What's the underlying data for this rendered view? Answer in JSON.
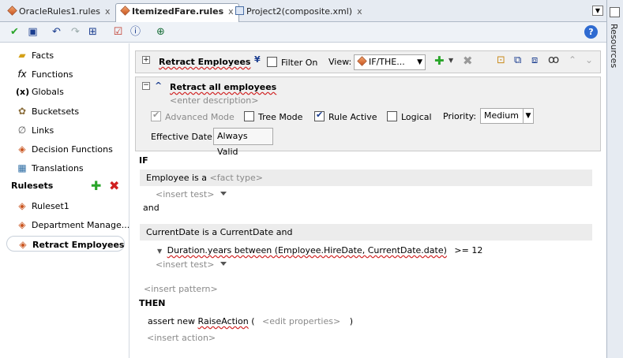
{
  "tabs": [
    {
      "label": "OracleRules1.rules",
      "close": "x"
    },
    {
      "label": "ItemizedFare.rules",
      "close": "x"
    },
    {
      "label": "Project2(composite.xml)",
      "close": "x"
    }
  ],
  "right_panel": {
    "label": "Resources"
  },
  "sidebar": {
    "items": [
      {
        "label": "Facts",
        "icon": "facts-icon"
      },
      {
        "label": "Functions",
        "icon": "fx-icon"
      },
      {
        "label": "Globals",
        "icon": "globals-icon"
      },
      {
        "label": "Bucketsets",
        "icon": "bucketsets-icon"
      },
      {
        "label": "Links",
        "icon": "links-icon"
      },
      {
        "label": "Decision Functions",
        "icon": "decision-functions-icon"
      },
      {
        "label": "Translations",
        "icon": "translations-icon"
      }
    ],
    "rulesets_header": "Rulesets",
    "rulesets": [
      {
        "label": "Ruleset1"
      },
      {
        "label": "Department Manage..."
      },
      {
        "label": "Retract Employees"
      }
    ]
  },
  "rule_header": {
    "title": "Retract Employees",
    "filter_label": "Filter On",
    "view_label": "View:",
    "view_value": "IF/THE..."
  },
  "rule": {
    "name": "Retract all employees",
    "description_placeholder": "<enter description>",
    "advanced_mode": "Advanced Mode",
    "tree_mode": "Tree Mode",
    "rule_active": "Rule Active",
    "logical": "Logical",
    "priority_label": "Priority:",
    "priority_value": "Medium",
    "effective_date_label": "Effective Date:",
    "effective_date_value": "Always Valid"
  },
  "body": {
    "if_label": "IF",
    "pattern1": {
      "text": "Employee is a",
      "placeholder": "<fact type>"
    },
    "insert_test_1": "<insert test>",
    "and_label": "and",
    "pattern2": {
      "text": "CurrentDate is a CurrentDate  and"
    },
    "test_expression": "Duration.years between (Employee.HireDate, CurrentDate.date)",
    "test_operator": ">=  12",
    "insert_test_2": "<insert test>",
    "insert_pattern": "<insert pattern>",
    "then_label": "THEN",
    "action_prefix": "assert new",
    "action_class": "RaiseAction",
    "action_paren_open": "(",
    "action_props": "<edit properties>",
    "action_paren_close": ")",
    "insert_action": "<insert action>"
  },
  "colors": {
    "accent_blue": "#1a3d8f",
    "add_green": "#2aa52a",
    "delete_red": "#d02020"
  }
}
